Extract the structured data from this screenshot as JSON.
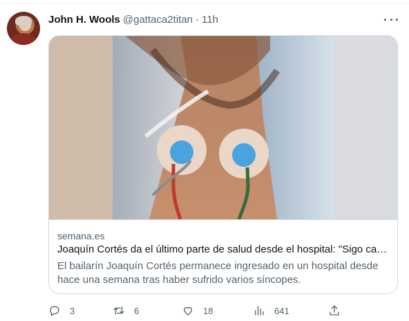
{
  "author": {
    "name": "John H. Wools",
    "handle": "@gattaca2titan",
    "separator": "·",
    "time": "11h"
  },
  "card": {
    "domain": "semana.es",
    "title": "Joaquín Cortés da el último parte de salud desde el hospital: \"Sigo can...",
    "description": "El bailarín Joaquín Cortés permanece ingresado en un hospital desde hace una semana tras haber sufrido varios síncopes."
  },
  "actions": {
    "replies": "3",
    "retweets": "6",
    "likes": "18",
    "views": "641"
  },
  "icons": [
    "more-icon",
    "reply-icon",
    "retweet-icon",
    "like-icon",
    "views-icon",
    "share-icon"
  ],
  "colors": {
    "text_primary": "#0f1419",
    "text_secondary": "#536471",
    "border": "#cfd9de",
    "electrode_blue": "#4aa3df"
  }
}
